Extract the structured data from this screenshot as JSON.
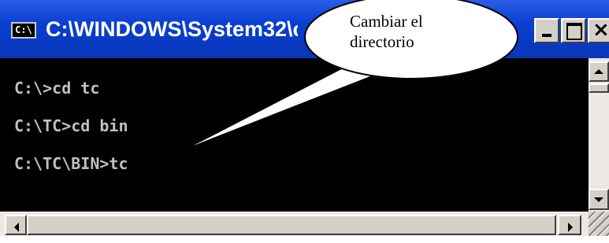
{
  "window": {
    "title": "C:\\WINDOWS\\System32\\cmd.exe",
    "icon_text": "C:\\"
  },
  "console": {
    "lines": [
      "C:\\>cd tc",
      "C:\\TC>cd bin",
      "C:\\TC\\BIN>tc"
    ]
  },
  "callout": {
    "line1": "Cambiar el",
    "line2": "directorio"
  },
  "colors": {
    "titlebar": "#0a3fd0",
    "console_bg": "#000000",
    "console_text": "#c0c0c0"
  }
}
